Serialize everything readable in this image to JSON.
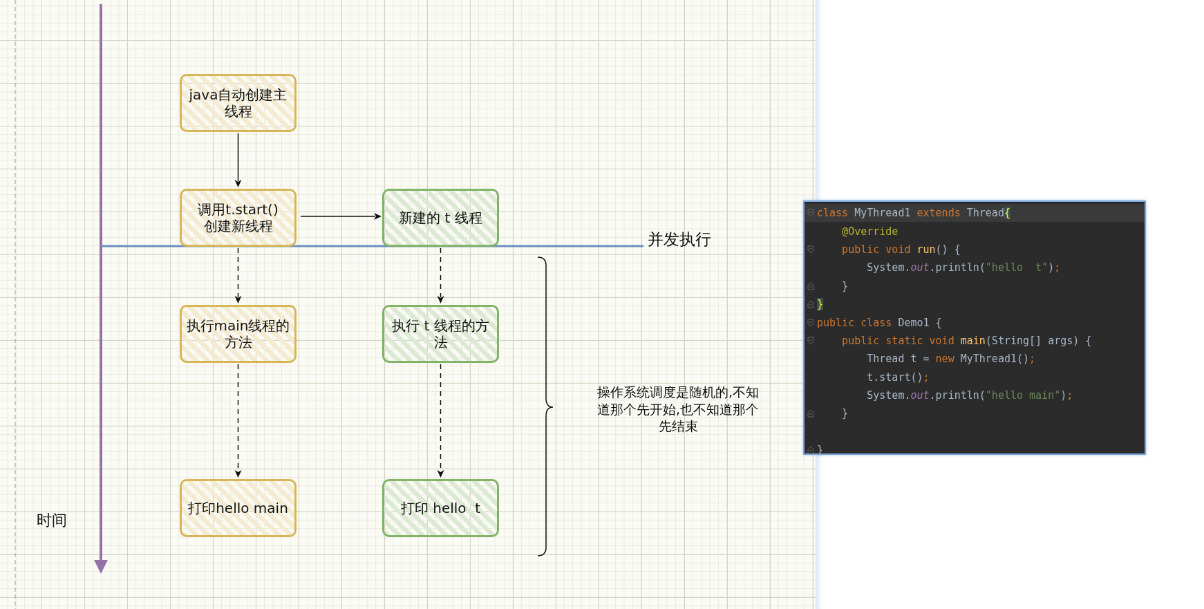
{
  "diagram": {
    "time_label": "时间",
    "concurrency_label": "并发执行",
    "note_lines": [
      "操作系统调度是随机的,不知",
      "道那个先开始,也不知道那个",
      "先结束"
    ],
    "columns": [
      {
        "color": "#d6b656",
        "nodes": [
          {
            "lines": [
              "java自动创建主",
              "线程"
            ]
          },
          {
            "lines": [
              "调用t.start()",
              "创建新线程"
            ],
            "incoming_dashed": false
          },
          {
            "lines": [
              "执行main线程的",
              "方法"
            ],
            "incoming_dashed": true
          },
          {
            "lines": [
              "打印hello main"
            ],
            "incoming_dashed": true
          }
        ]
      },
      {
        "color": "#82b366",
        "nodes": [
          {
            "lines": [
              "新建的 t 线程"
            ],
            "incoming_from_left": true
          },
          {
            "lines": [
              "执行 t 线程的方",
              "法"
            ],
            "incoming_dashed": true
          },
          {
            "lines": [
              "打印 hello  t"
            ],
            "incoming_dashed": true
          }
        ]
      }
    ]
  },
  "code_editor": {
    "lines": [
      {
        "fold_start": true,
        "current": true,
        "tokens": [
          {
            "kind": "keyword",
            "text": "class "
          },
          {
            "kind": "plain",
            "text": "MyThread1 "
          },
          {
            "kind": "keyword",
            "text": "extends "
          },
          {
            "kind": "plain",
            "text": "Thread"
          },
          {
            "kind": "brace_match",
            "text": "{"
          }
        ]
      },
      {
        "current": false,
        "tokens": [
          {
            "kind": "annotation",
            "text": "    @Override"
          }
        ]
      },
      {
        "fold_start": true,
        "current": false,
        "tokens": [
          {
            "kind": "keyword",
            "text": "    public void "
          },
          {
            "kind": "method",
            "text": "run"
          },
          {
            "kind": "plain",
            "text": "() {"
          }
        ]
      },
      {
        "current": false,
        "tokens": [
          {
            "kind": "plain",
            "text": "        System."
          },
          {
            "kind": "field",
            "text": "out"
          },
          {
            "kind": "plain",
            "text": ".println("
          },
          {
            "kind": "string",
            "text": "\"hello  t\""
          },
          {
            "kind": "plain",
            "text": ")"
          },
          {
            "kind": "keyword",
            "text": ";"
          }
        ]
      },
      {
        "fold_end": true,
        "current": false,
        "tokens": [
          {
            "kind": "plain",
            "text": "    }"
          }
        ]
      },
      {
        "fold_end": true,
        "current": false,
        "tokens": [
          {
            "kind": "brace_match",
            "text": "}"
          }
        ]
      },
      {
        "fold_start": true,
        "current": false,
        "tokens": [
          {
            "kind": "keyword",
            "text": "public class "
          },
          {
            "kind": "plain",
            "text": "Demo1 {"
          }
        ]
      },
      {
        "fold_start": true,
        "current": false,
        "tokens": [
          {
            "kind": "keyword",
            "text": "    public static void "
          },
          {
            "kind": "method",
            "text": "main"
          },
          {
            "kind": "plain",
            "text": "(String[] args) {"
          }
        ]
      },
      {
        "current": false,
        "tokens": [
          {
            "kind": "plain",
            "text": "        Thread t = "
          },
          {
            "kind": "keyword",
            "text": "new "
          },
          {
            "kind": "plain",
            "text": "MyThread1()"
          },
          {
            "kind": "keyword",
            "text": ";"
          }
        ]
      },
      {
        "current": false,
        "tokens": [
          {
            "kind": "plain",
            "text": "        t.start()"
          },
          {
            "kind": "keyword",
            "text": ";"
          }
        ]
      },
      {
        "current": false,
        "tokens": [
          {
            "kind": "plain",
            "text": "        System."
          },
          {
            "kind": "field",
            "text": "out"
          },
          {
            "kind": "plain",
            "text": ".println("
          },
          {
            "kind": "string",
            "text": "\"hello main\""
          },
          {
            "kind": "plain",
            "text": ")"
          },
          {
            "kind": "keyword",
            "text": ";"
          }
        ]
      },
      {
        "fold_end": true,
        "current": false,
        "tokens": [
          {
            "kind": "plain",
            "text": "    }"
          }
        ]
      },
      {
        "fold_end": true,
        "current": false,
        "gap_before": true,
        "tokens": [
          {
            "kind": "plain",
            "text": "}"
          }
        ]
      }
    ]
  }
}
